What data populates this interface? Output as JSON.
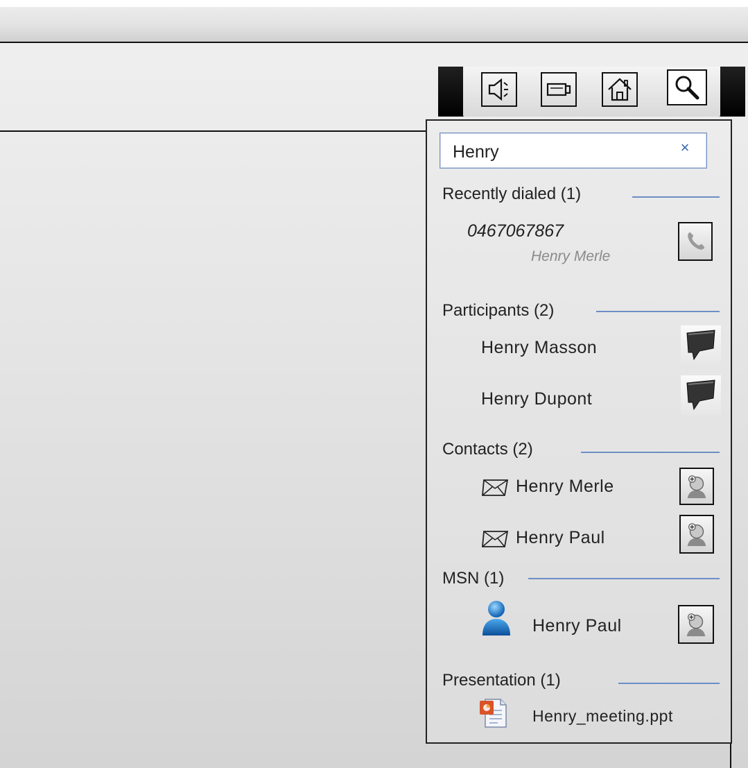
{
  "search": {
    "value": "Henry",
    "clear_label": "×"
  },
  "toolbar": {
    "buttons": [
      {
        "name": "speaker-icon"
      },
      {
        "name": "video-camera-icon"
      },
      {
        "name": "home-icon"
      },
      {
        "name": "search-icon"
      }
    ]
  },
  "sections": {
    "recently_dialed": {
      "title": "Recently dialed (1)",
      "items": [
        {
          "number": "0467067867",
          "name": "Henry Merle",
          "action_icon": "phone-icon"
        }
      ]
    },
    "participants": {
      "title": "Participants (2)",
      "items": [
        {
          "name": "Henry Masson",
          "action_icon": "chat-bubble-icon"
        },
        {
          "name": "Henry  Dupont",
          "action_icon": "chat-bubble-icon"
        }
      ]
    },
    "contacts": {
      "title": "Contacts (2)",
      "items": [
        {
          "name": "Henry  Merle",
          "lead_icon": "envelope-icon",
          "action_icon": "add-contact-icon"
        },
        {
          "name": "Henry  Paul",
          "lead_icon": "envelope-icon",
          "action_icon": "add-contact-icon"
        }
      ]
    },
    "msn": {
      "title": "MSN (1)",
      "items": [
        {
          "name": "Henry  Paul",
          "lead_icon": "msn-user-icon",
          "action_icon": "add-contact-icon"
        }
      ]
    },
    "presentation": {
      "title": "Presentation (1)",
      "items": [
        {
          "name": "Henry_meeting.ppt",
          "lead_icon": "powerpoint-file-icon"
        }
      ]
    }
  },
  "colors": {
    "rule": "#6d8ec4",
    "search_border": "#7a92c0",
    "toolbar_dark": "#000000"
  }
}
